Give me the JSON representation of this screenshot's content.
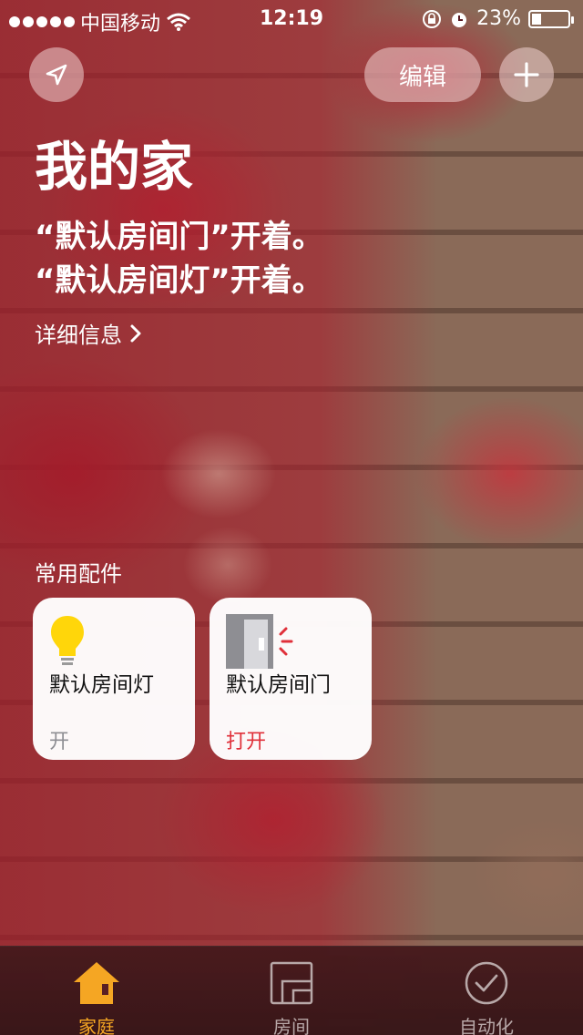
{
  "status_bar": {
    "carrier": "中国移动",
    "time": "12:19",
    "battery": "23%"
  },
  "header": {
    "location_icon": "location-arrow-icon",
    "edit_label": "编辑",
    "add_icon": "plus-icon"
  },
  "home": {
    "title": "我的家",
    "status_lines": [
      "“默认房间门”开着。",
      "“默认房间灯”开着。"
    ],
    "details_label": "详细信息"
  },
  "favorites": {
    "section_label": "常用配件",
    "tiles": [
      {
        "name": "默认房间灯",
        "state": "开",
        "icon": "lightbulb-icon",
        "state_color": "#8e8e93"
      },
      {
        "name": "默认房间门",
        "state": "打开",
        "icon": "door-icon",
        "state_color": "#e0303a"
      }
    ]
  },
  "tab_bar": {
    "tabs": [
      {
        "label": "家庭",
        "icon": "house-icon",
        "active": true
      },
      {
        "label": "房间",
        "icon": "rooms-icon",
        "active": false
      },
      {
        "label": "自动化",
        "icon": "clock-icon",
        "active": false
      }
    ],
    "active_color": "#f5a623",
    "inactive_color": "#b8a8a8"
  }
}
